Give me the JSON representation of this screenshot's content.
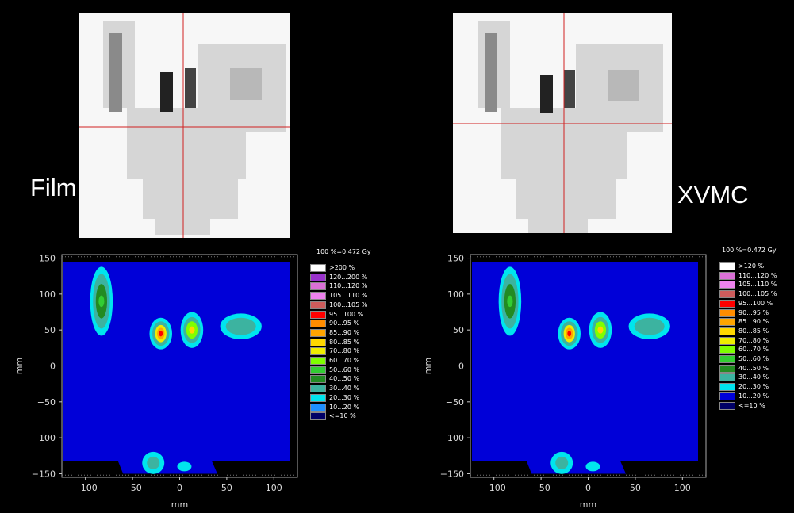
{
  "labels": {
    "left": "Film",
    "right": "XVMC"
  },
  "colors": {
    "background": "#000000",
    "crosshair": "#d02020",
    "dose_levels": [
      "#000066",
      "#0000d8",
      "#1e90ff",
      "#00e5ee",
      "#3cb3a0",
      "#228b22",
      "#32cd32",
      "#7fff00",
      "#eeee00",
      "#ffd700",
      "#ffa500",
      "#ff8c00",
      "#ff0000",
      "#cd5c5c",
      "#ee82ee",
      "#da70d6",
      "#9932cc",
      "#ffffff"
    ]
  },
  "chart_data": [
    {
      "type": "heatmap",
      "name": "Film",
      "xlabel": "mm",
      "ylabel": "mm",
      "xlim": [
        -125,
        125
      ],
      "ylim": [
        -155,
        155
      ],
      "xticks": [
        -100,
        -50,
        0,
        50,
        100
      ],
      "yticks": [
        150,
        100,
        50,
        0,
        -50,
        -100,
        -150
      ],
      "xtick_labels": [
        "−100",
        "−50",
        "0",
        "50",
        "100"
      ],
      "ytick_labels": [
        "150",
        "100",
        "50",
        "0",
        "−50",
        "−100",
        "−150"
      ],
      "legend_title": "100 %=0.472 Gy",
      "legend": [
        {
          "label": ">200 %",
          "color": "#ffffff"
        },
        {
          "label": "120...200 %",
          "color": "#9932cc"
        },
        {
          "label": "110...120 %",
          "color": "#da70d6"
        },
        {
          "label": "105...110 %",
          "color": "#ee82ee"
        },
        {
          "label": "100...105 %",
          "color": "#cd5c5c"
        },
        {
          "label": "95...100 %",
          "color": "#ff0000"
        },
        {
          "label": "90...95 %",
          "color": "#ff8c00"
        },
        {
          "label": "85...90 %",
          "color": "#ffa500"
        },
        {
          "label": "80...85 %",
          "color": "#ffd700"
        },
        {
          "label": "70...80 %",
          "color": "#eeee00"
        },
        {
          "label": "60...70 %",
          "color": "#7fff00"
        },
        {
          "label": "50...60 %",
          "color": "#32cd32"
        },
        {
          "label": "40...50 %",
          "color": "#228b22"
        },
        {
          "label": "30...40 %",
          "color": "#3cb3a0"
        },
        {
          "label": "20...30 %",
          "color": "#00e5ee"
        },
        {
          "label": "10...20 %",
          "color": "#1e90ff"
        },
        {
          "label": "<=10 %",
          "color": "#000066"
        }
      ],
      "hotspots": [
        {
          "x": -83,
          "y": 100,
          "peak": "50...60 %"
        },
        {
          "x": -20,
          "y": 50,
          "peak": "95...100 %"
        },
        {
          "x": 13,
          "y": 55,
          "peak": "70...80 %"
        },
        {
          "x": 65,
          "y": 55,
          "peak": "20...30 %"
        }
      ]
    },
    {
      "type": "heatmap",
      "name": "XVMC",
      "xlabel": "mm",
      "ylabel": "mm",
      "xlim": [
        -125,
        125
      ],
      "ylim": [
        -155,
        155
      ],
      "xticks": [
        -100,
        -50,
        0,
        50,
        100
      ],
      "yticks": [
        150,
        100,
        50,
        0,
        -50,
        -100,
        -150
      ],
      "xtick_labels": [
        "−100",
        "−50",
        "0",
        "50",
        "100"
      ],
      "ytick_labels": [
        "150",
        "100",
        "50",
        "0",
        "−50",
        "−100",
        "−150"
      ],
      "legend_title": "100 %=0.472 Gy",
      "legend": [
        {
          "label": ">120 %",
          "color": "#ffffff"
        },
        {
          "label": "110...120 %",
          "color": "#da70d6"
        },
        {
          "label": "105...110 %",
          "color": "#ee82ee"
        },
        {
          "label": "100...105 %",
          "color": "#cd5c5c"
        },
        {
          "label": "95...100 %",
          "color": "#ff0000"
        },
        {
          "label": "90...95 %",
          "color": "#ff8c00"
        },
        {
          "label": "85...90 %",
          "color": "#ffa500"
        },
        {
          "label": "80...85 %",
          "color": "#ffd700"
        },
        {
          "label": "70...80 %",
          "color": "#eeee00"
        },
        {
          "label": "60...70 %",
          "color": "#7fff00"
        },
        {
          "label": "50...60 %",
          "color": "#32cd32"
        },
        {
          "label": "40...50 %",
          "color": "#228b22"
        },
        {
          "label": "30...40 %",
          "color": "#3cb3a0"
        },
        {
          "label": "20...30 %",
          "color": "#00e5ee"
        },
        {
          "label": "10...20 %",
          "color": "#0000d8"
        },
        {
          "label": "<=10 %",
          "color": "#000066"
        }
      ],
      "hotspots": [
        {
          "x": -83,
          "y": 100,
          "peak": "50...60 %"
        },
        {
          "x": -20,
          "y": 50,
          "peak": "90...95 %"
        },
        {
          "x": 13,
          "y": 55,
          "peak": "70...80 %"
        },
        {
          "x": 65,
          "y": 55,
          "peak": "20...30 %"
        }
      ]
    }
  ]
}
